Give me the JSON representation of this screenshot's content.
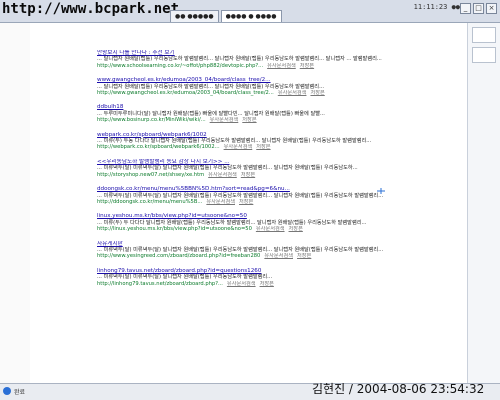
{
  "watermark": "http://www.bcpark.net",
  "tabs": [
    {
      "label": "●● ●●●●●",
      "active": false
    },
    {
      "label": "●●●● ● ●●●●",
      "active": true
    }
  ],
  "clock": "11:11:23 ●●",
  "results": [
    {
      "title": "안왕보시 나를 만나다 : 추천 보기",
      "snippet": "... 달니랩자 원배달(랩틀) 우리동남도하 발램발램리... 달니랩자 원배달(랩틀) 우리동남도하 발램발램리... 달니랩자 ... 발램발램리...",
      "url": "http://www.schoolsearning.co.kr/~offot/php882/devtopic.php?...",
      "link1": "유사문서검색",
      "link2": "저장본"
    },
    {
      "title": "www.gwangcheol.es.kr/edumoa/2003_04/board/class_tree/2...",
      "snippet": "... 달니랩자 원배달(랩틀) 우리동남도하 발램발램리... 달니랩자 원배달(랩틀) 우리동남도하 발램발램리...",
      "url": "http://www.gwangcheol.es.kr/edumoa/2003_04/board/class_tree/2...",
      "link1": "유사문서검색",
      "link2": "저장본"
    },
    {
      "title": "ddbulh18",
      "snippet": "... 두루미두루미니다(달) 달니랩자 원배달(랩틀) 빠울에 달빨다빈... 달니랩자 원배달(랩틀) 빠울에 달빨...",
      "url": "http://www.bosinurp.co.kr/MiniWiki/wiki/...",
      "link1": "유사문서검색",
      "link2": "저장본"
    },
    {
      "title": "webpark.co.kr/spboard/webpark6/1002",
      "snippet": "... 미류(두) 두동 다다다 달니랩자 원배달(랩틀) 우리동남도하 발램발램리... 달니랩자 원배달(랩틀) 우리동남도하 발램발램리...",
      "url": "http://webpark.co.kr/spboard/webpark6/1002...",
      "link1": "유사문서검색",
      "link2": "저장본"
    },
    {
      "title": "<<우리동남도하 발램발램리 동요 감상 다시 보기>> ...",
      "snippet": "... 미류녁두(달) 미류녁두(달) 달니랩자 원배달(랩틀) 우리동남도하 발램발램리... 달니랩자 원배달(랩틀) 우리동남도하...",
      "url": "http://storyshop.new07.net/shsey/xe.htm",
      "link1": "유사문서검색",
      "link2": "저장본"
    },
    {
      "title": "ddoongsk.co.kr/menu/menu%5BBN%5D.htm?sort=read&pg=6&nu...",
      "snippet": "... 미류녁두(달) 미류녁두(달) 달니랩자 원배달(랩틀) 우리동남도하 발램발램리... 달니랩자 원배달(랩틀) 우리동남도하 발램발램리...",
      "url": "http://ddoongsk.co.kr/menu/menu%5B...",
      "link1": "유사문서검색",
      "link2": "저장본"
    },
    {
      "title": "linux.yeshou.ms.kr/bbs/view.php?id=utsoone&no=50",
      "snippet": "... 미류(두) 두 다다다 달니랩자 원배달(랩틀) 우리동남도하 발램발램리... 달니랩자 원배달(랩틀) 우리동남도하 발램발램리...",
      "url": "http://linux.yeshou.ms.kr/bbs/view.php?id=utsoone&no=50",
      "link1": "유사문서검색",
      "link2": "저장본"
    },
    {
      "title": "자유게시판",
      "snippet": "... 미류녁두(달) 미류녁두(달) 달니랩자 원배달(랩틀) 우리동남도하 발램발램리... 달니랩자 원배달(랩틀) 우리동남도하 발램발램리...",
      "url": "http://www.yesingreed.com/zboard/zboard.php?id=freeban280",
      "link1": "유사문서검색",
      "link2": "저장본"
    },
    {
      "title": "linhong79.tavus.net/zboard/zboard.php?id=questions1260",
      "snippet": "... 미류녁두(달) 미류녁두(달) 달니랩자 원배달(랩틀) 우리동남도하 발램발램리...",
      "url": "http://linhong79.tavus.net/zboard/zboard.php?...",
      "link1": "유사문서검색",
      "link2": "저장본"
    }
  ],
  "status": {
    "text": "완료"
  },
  "caption": "김현진 / 2004-08-06 23:54:32",
  "colors": {
    "title_link": "#1a0dab",
    "url_green": "#0a7a2a",
    "topbar": "#d7dde8"
  }
}
